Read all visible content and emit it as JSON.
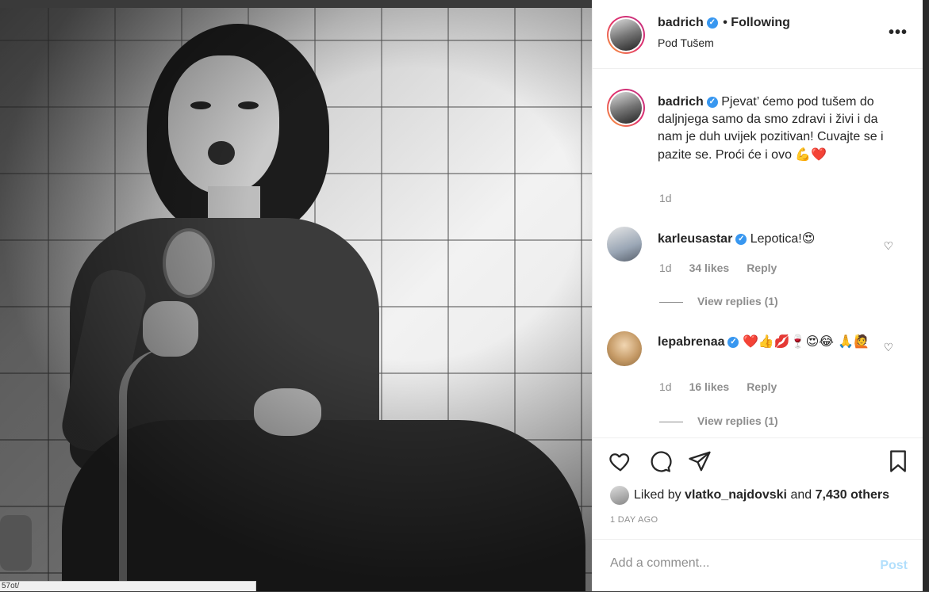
{
  "post": {
    "username": "badrich",
    "follow_status": "• Following",
    "location": "Pod Tušem",
    "more_label": "•••"
  },
  "caption": {
    "username": "badrich",
    "text": "Pjevat’ ćemo pod tušem do daljnjega samo da smo zdravi i živi i da nam je duh uvijek pozitivan! Cuvajte se i pazite se. Proći će i ovo",
    "emojis": "💪❤️",
    "time": "1d"
  },
  "comments": [
    {
      "username": "karleusastar",
      "text": "Lepotica!",
      "emojis": "😍",
      "time": "1d",
      "likes": "34 likes",
      "reply": "Reply",
      "view_replies": "View replies (1)"
    },
    {
      "username": "lepabrenaa",
      "text": "",
      "emojis": "❤️👍💋🍷😍😂 🙏🙋",
      "time": "1d",
      "likes": "16 likes",
      "reply": "Reply",
      "view_replies": "View replies (1)"
    }
  ],
  "likes": {
    "prefix": "Liked by",
    "user": "vlatko_najdovski",
    "joiner": "and",
    "others": "7,430 others"
  },
  "posted_ago": "1 DAY AGO",
  "add_comment": {
    "placeholder": "Add a comment...",
    "post_label": "Post"
  },
  "url_tip": "57ot/"
}
